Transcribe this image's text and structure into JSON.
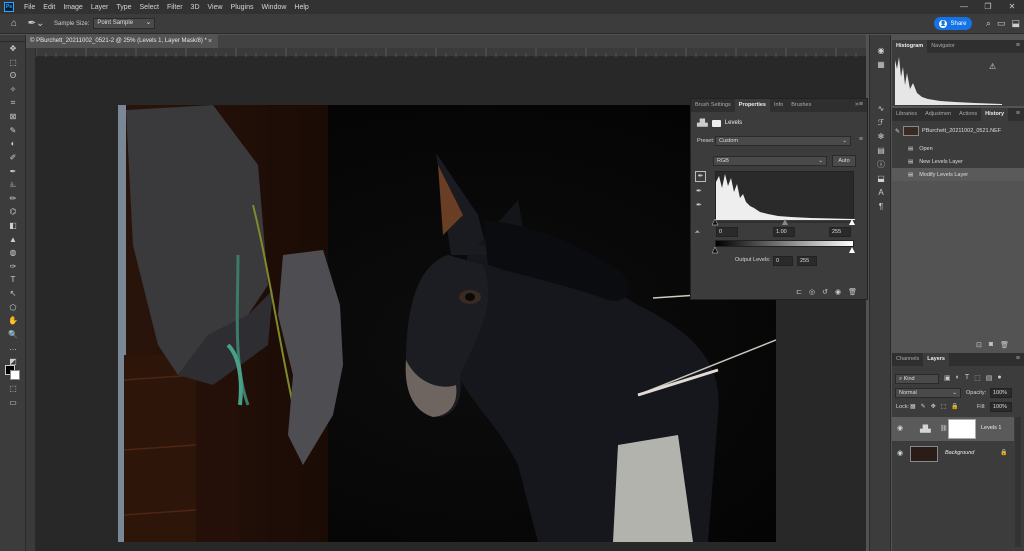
{
  "menu": [
    "File",
    "Edit",
    "Image",
    "Layer",
    "Type",
    "Select",
    "Filter",
    "3D",
    "View",
    "Plugins",
    "Window",
    "Help"
  ],
  "window_controls": [
    "—",
    "❐",
    "✕"
  ],
  "options_bar": {
    "sample_size_label": "Sample Size:",
    "sample_size_value": "Point Sample",
    "share_label": "Share"
  },
  "document_tab": {
    "title": "© PBurchett_20211002_0521-2 @ 25% (Levels 1, Layer Mask/8) *",
    "close": "×"
  },
  "tools": [
    "✥",
    "⬚",
    "ʘ",
    "✧",
    "⌗",
    "⊠",
    "✎",
    "◐",
    "✐",
    "✒",
    "⎁",
    "✏",
    "⌬",
    "◧",
    "▲",
    "◍",
    "✑",
    "T",
    "↖",
    "⬠",
    "✋",
    "🔍",
    "…",
    "◩",
    "■",
    "⬚",
    "▭"
  ],
  "side_icons": [
    "◉",
    "▦",
    "∿",
    "ℱ",
    "✻",
    "▤",
    "ⓘ",
    "⬓",
    "A",
    "¶"
  ],
  "histogram_panel": {
    "tabs": [
      "Histogram",
      "Navigator"
    ],
    "active_tab": 0
  },
  "history_panel": {
    "tabs": [
      "Libraries",
      "Adjustmen",
      "Actions",
      "History"
    ],
    "active_tab": 3,
    "snapshot": "PBurchett_20211002_0521.NEF",
    "items": [
      "Open",
      "New Levels Layer",
      "Modify Levels Layer"
    ]
  },
  "layers_panel": {
    "tabs": [
      "Channels",
      "Layers"
    ],
    "active_tab": 1,
    "kind": "Kind",
    "blend_mode": "Normal",
    "opacity_label": "Opacity:",
    "opacity_value": "100%",
    "lock_label": "Lock:",
    "fill_label": "Fill:",
    "fill_value": "100%",
    "layers": [
      {
        "name": "Levels 1"
      },
      {
        "name": "Background"
      }
    ]
  },
  "properties_panel": {
    "tabs": [
      "Brush Settings",
      "Properties",
      "Info",
      "Brushes"
    ],
    "active_tab": 1,
    "title": "Levels",
    "preset_label": "Preset:",
    "preset_value": "Custom",
    "channel": "RGB",
    "auto_label": "Auto",
    "input_levels": [
      "0",
      "1.00",
      "255"
    ],
    "output_label": "Output Levels:",
    "output_levels": [
      "0",
      "255"
    ]
  }
}
